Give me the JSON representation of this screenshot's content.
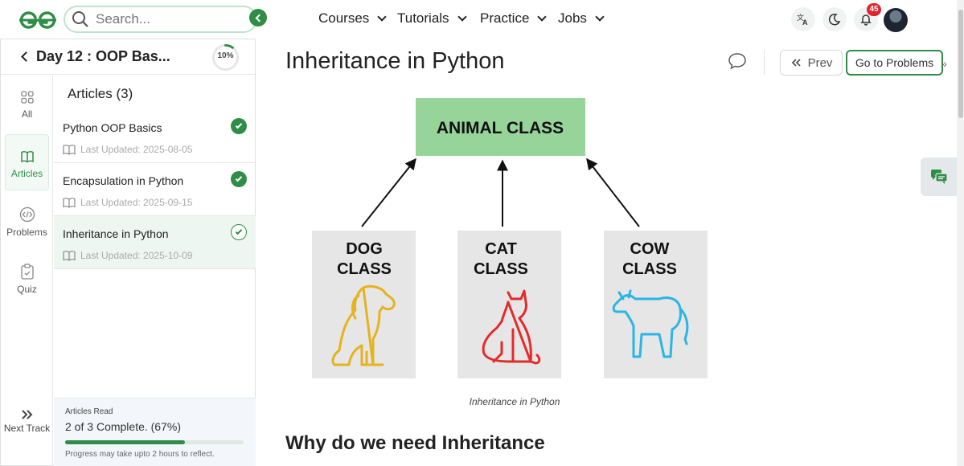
{
  "header": {
    "search_placeholder": "Search...",
    "nav": [
      "Courses",
      "Tutorials",
      "Practice",
      "Jobs"
    ],
    "notification_count": "45"
  },
  "sidebar": {
    "day_title": "Day 12 : OOP Bas...",
    "progress_ring_label": "10%",
    "progress_ring_value": 0.1,
    "rail": [
      {
        "label": "All",
        "icon": "grid-icon"
      },
      {
        "label": "Articles",
        "icon": "book-icon"
      },
      {
        "label": "Problems",
        "icon": "code-icon"
      },
      {
        "label": "Quiz",
        "icon": "clipboard-icon"
      }
    ],
    "next_track_label": "Next Track",
    "articles_heading": "Articles (3)",
    "articles": [
      {
        "title": "Python OOP Basics",
        "updated": "Last Updated: 2025-08-05"
      },
      {
        "title": "Encapsulation in Python",
        "updated": "Last Updated: 2025-09-15"
      },
      {
        "title": "Inheritance in Python",
        "updated": "Last Updated: 2025-10-09"
      }
    ],
    "progress": {
      "label": "Articles Read",
      "status_prefix": "2",
      "status_middle": " of ",
      "status_total": "3",
      "status_suffix": " Complete. (67%)",
      "fraction": 0.67,
      "note": "Progress may take upto 2 hours to reflect."
    }
  },
  "main": {
    "title": "Inheritance in Python",
    "prev_label": "Prev",
    "goto_label": "Go to Problems",
    "diagram": {
      "parent": "ANIMAL CLASS",
      "children": [
        {
          "line1": "DOG",
          "line2": "CLASS",
          "color": "#e6b31e"
        },
        {
          "line1": "CAT",
          "line2": "CLASS",
          "color": "#e32b2b"
        },
        {
          "line1": "COW",
          "line2": "CLASS",
          "color": "#29b6e6"
        }
      ],
      "parent_color": "#97d49a"
    },
    "caption": "Inheritance in Python",
    "section_heading": "Why do we need Inheritance"
  },
  "colors": {
    "accent": "#2f8d46",
    "badge": "#e0242c"
  }
}
